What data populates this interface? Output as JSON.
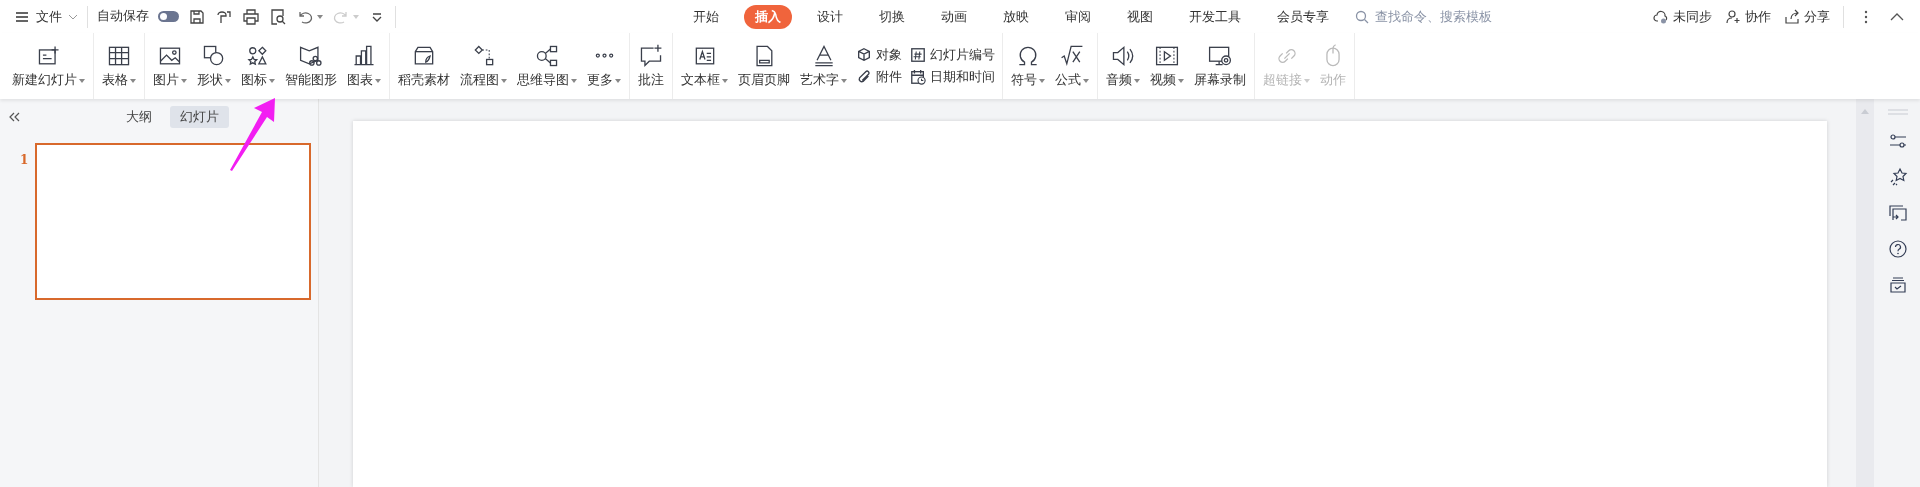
{
  "quick_bar": {
    "menu_label": "文件",
    "autosave": {
      "label": "自动保存",
      "on": false
    }
  },
  "tabs": [
    {
      "label": "开始",
      "selected": false
    },
    {
      "label": "插入",
      "selected": true
    },
    {
      "label": "设计",
      "selected": false
    },
    {
      "label": "切换",
      "selected": false
    },
    {
      "label": "动画",
      "selected": false
    },
    {
      "label": "放映",
      "selected": false
    },
    {
      "label": "审阅",
      "selected": false
    },
    {
      "label": "视图",
      "selected": false
    },
    {
      "label": "开发工具",
      "selected": false
    },
    {
      "label": "会员专享",
      "selected": false
    }
  ],
  "search": {
    "placeholder": "查找命令、搜索模板"
  },
  "account_actions": [
    "未同步",
    "协作",
    "分享"
  ],
  "ribbon": {
    "groups": [
      [
        {
          "kind": "large",
          "label": "新建幻灯片",
          "dropdown": true,
          "disabled": false
        }
      ],
      [
        {
          "kind": "large",
          "label": "表格",
          "dropdown": true,
          "disabled": false
        }
      ],
      [
        {
          "kind": "large",
          "label": "图片",
          "dropdown": true,
          "disabled": false
        },
        {
          "kind": "large",
          "label": "形状",
          "dropdown": true,
          "disabled": false
        },
        {
          "kind": "large",
          "label": "图标",
          "dropdown": true,
          "disabled": false
        },
        {
          "kind": "large",
          "label": "智能图形",
          "dropdown": false,
          "disabled": false
        },
        {
          "kind": "large",
          "label": "图表",
          "dropdown": true,
          "disabled": false
        }
      ],
      [
        {
          "kind": "large",
          "label": "稻壳素材",
          "dropdown": false,
          "disabled": false
        },
        {
          "kind": "large",
          "label": "流程图",
          "dropdown": true,
          "disabled": false
        },
        {
          "kind": "large",
          "label": "思维导图",
          "dropdown": true,
          "disabled": false
        },
        {
          "kind": "large",
          "label": "更多",
          "dropdown": true,
          "disabled": false
        }
      ],
      [
        {
          "kind": "large",
          "label": "批注",
          "dropdown": false,
          "disabled": false
        }
      ],
      [
        {
          "kind": "large",
          "label": "文本框",
          "dropdown": true,
          "disabled": false
        },
        {
          "kind": "large",
          "label": "页眉页脚",
          "dropdown": false,
          "disabled": false
        },
        {
          "kind": "large",
          "label": "艺术字",
          "dropdown": true,
          "disabled": false
        },
        {
          "kind": "stack",
          "rows": [
            {
              "label": "对象"
            },
            {
              "label": "附件"
            }
          ]
        },
        {
          "kind": "stack",
          "rows": [
            {
              "label": "幻灯片编号"
            },
            {
              "label": "日期和时间"
            }
          ]
        }
      ],
      [
        {
          "kind": "large",
          "label": "符号",
          "dropdown": true,
          "disabled": false
        },
        {
          "kind": "large",
          "label": "公式",
          "dropdown": true,
          "disabled": false
        }
      ],
      [
        {
          "kind": "large",
          "label": "音频",
          "dropdown": true,
          "disabled": false
        },
        {
          "kind": "large",
          "label": "视频",
          "dropdown": true,
          "disabled": false
        },
        {
          "kind": "large",
          "label": "屏幕录制",
          "dropdown": false,
          "disabled": false
        }
      ],
      [
        {
          "kind": "large",
          "label": "超链接",
          "dropdown": true,
          "disabled": true
        },
        {
          "kind": "large",
          "label": "动作",
          "dropdown": false,
          "disabled": true
        }
      ]
    ]
  },
  "outline_tabs": [
    {
      "label": "大纲",
      "selected": false
    },
    {
      "label": "幻灯片",
      "selected": true
    }
  ],
  "slides": [
    {
      "number": "1",
      "selected": true
    }
  ]
}
